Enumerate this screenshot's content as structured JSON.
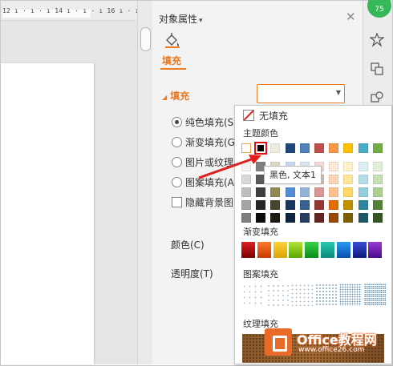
{
  "ruler": {
    "text": "12 ı · ı · ı 14 ı · ı · ı 16 ı · ı"
  },
  "pane": {
    "title": "对象属性",
    "tab_fill": "填充",
    "section_fill": "填充",
    "options": {
      "solid": "纯色填充(S",
      "gradient": "渐变填充(G",
      "picture": "图片或纹理",
      "pattern": "图案填充(A",
      "hide_bg": "隐藏背景图"
    },
    "color_label": "颜色(C)",
    "transparency_label": "透明度(T)"
  },
  "badge": "75",
  "popup": {
    "no_fill": "无填充",
    "theme_colors_label": "主题颜色",
    "gradient_label": "渐变填充",
    "pattern_label": "图案填充",
    "texture_label": "纹理填充",
    "theme_top_row": [
      "#ffffff",
      "#000000",
      "#eeece1",
      "#1f497d",
      "#4f81bd",
      "#c0504d",
      "#f79646",
      "#ffc000",
      "#4bacc6",
      "#70ad47"
    ],
    "theme_shades": [
      [
        "#f2f2f2",
        "#7f7f7f",
        "#ddd9c3",
        "#c6d9f0",
        "#dbe5f1",
        "#f2dcdb",
        "#fde9d9",
        "#fff2cc",
        "#dbeef3",
        "#e2efda"
      ],
      [
        "#d8d8d8",
        "#595959",
        "#c4bd97",
        "#8db3e2",
        "#b8cce4",
        "#e5b9b7",
        "#fbd5b5",
        "#ffe699",
        "#b7dde8",
        "#c6e0b4"
      ],
      [
        "#bfbfbf",
        "#3f3f3f",
        "#938953",
        "#548dd4",
        "#95b3d7",
        "#d99694",
        "#fac08f",
        "#ffd966",
        "#92cddc",
        "#a9d08e"
      ],
      [
        "#a5a5a5",
        "#262626",
        "#494429",
        "#17365d",
        "#366092",
        "#953734",
        "#e36c09",
        "#bf9000",
        "#31859b",
        "#548235"
      ],
      [
        "#7f7f7f",
        "#0c0c0c",
        "#1d1b10",
        "#0f243e",
        "#244061",
        "#632423",
        "#974806",
        "#7f6000",
        "#205867",
        "#375623"
      ]
    ],
    "gradients": [
      [
        "#e02020",
        "#7a0000"
      ],
      [
        "#ff7a2a",
        "#c73a00"
      ],
      [
        "#ffd23a",
        "#d9a400"
      ],
      [
        "#b6e23a",
        "#5aa800"
      ],
      [
        "#3ad24a",
        "#0a8a1a"
      ],
      [
        "#2ac9b0",
        "#0a8a7a"
      ],
      [
        "#2a9af0",
        "#0a4fb0"
      ],
      [
        "#3a4ad8",
        "#101a7a"
      ],
      [
        "#9a3ad8",
        "#4a0a8a"
      ]
    ],
    "hovered_swatch_name": "黑色, 文本1"
  },
  "watermark": {
    "brand": "Office教程网",
    "url": "www.office26.com"
  },
  "colors": {
    "accent": "#ea7a22",
    "pointer_arrow": "#e0201c"
  }
}
